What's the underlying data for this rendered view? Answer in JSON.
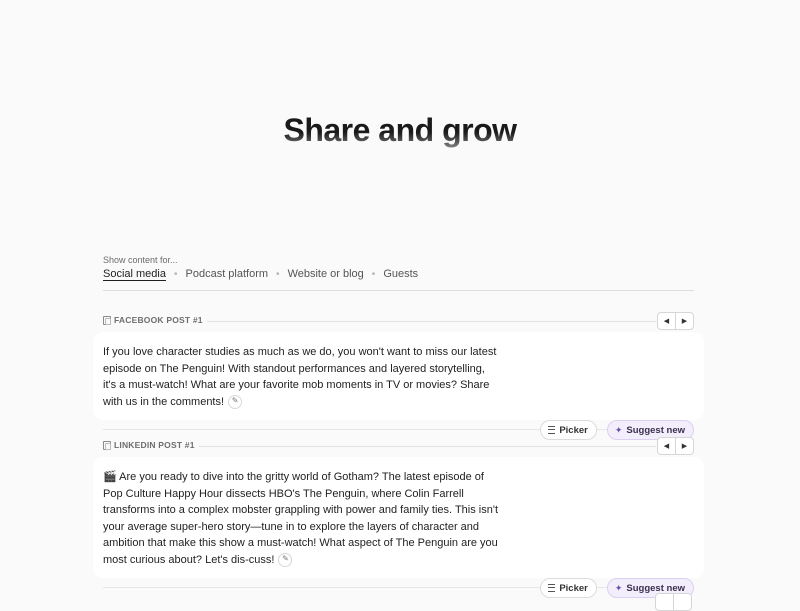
{
  "hero": {
    "title": "Share and grow"
  },
  "filter": {
    "label": "Show content for...",
    "tabs": [
      {
        "label": "Social media",
        "active": true
      },
      {
        "label": "Podcast platform",
        "active": false
      },
      {
        "label": "Website or blog",
        "active": false
      },
      {
        "label": "Guests",
        "active": false
      }
    ]
  },
  "posts": [
    {
      "label": "FACEBOOK POST #1",
      "text": "If you love character studies as much as we do, you won't want to miss our latest episode on The Penguin! With standout performances and layered storytelling, it's a must-watch! What are your favorite mob moments in TV or movies? Share with us in the comments!",
      "picker_label": "Picker",
      "suggest_label": "Suggest new"
    },
    {
      "label": "LINKEDIN POST #1",
      "text": "🎬 Are you ready to dive into the gritty world of Gotham? The latest episode of Pop Culture Happy Hour dissects HBO's The Penguin, where Colin Farrell transforms into a complex mobster grappling with power and family ties. This isn't your average super-hero story—tune in to explore the layers of character and ambition that make this show a must-watch! What aspect of The Penguin are you most curious about? Let's dis-cuss!",
      "picker_label": "Picker",
      "suggest_label": "Suggest new"
    }
  ],
  "icons": {
    "prev": "chevron-left-icon",
    "next": "chevron-right-icon",
    "edit": "pencil-icon",
    "picker": "list-icon",
    "suggest": "sparkle-icon",
    "copy": "copy-icon"
  },
  "colors": {
    "accent_suggest_bg": "#f3eefb",
    "page_bg": "#fafafa"
  }
}
